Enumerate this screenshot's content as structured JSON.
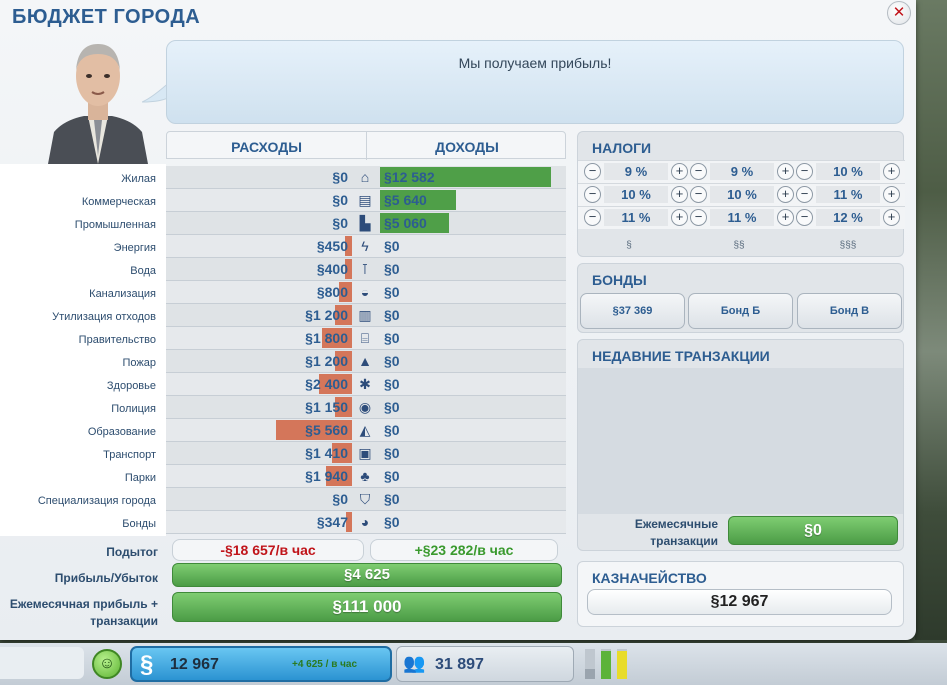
{
  "window": {
    "title": "БЮДЖЕТ ГОРОДА",
    "close_label": "✕"
  },
  "advisor": {
    "message": "Мы получаем прибыль!"
  },
  "columns": {
    "expenses": "РАСХОДЫ",
    "income": "ДОХОДЫ"
  },
  "rows": [
    {
      "label": "Жилая",
      "expense": "§0",
      "expense_fill": 0,
      "icon": "house-icon",
      "glyph": "⌂",
      "income": "§12 582",
      "income_fill": 0.92
    },
    {
      "label": "Коммерческая",
      "expense": "§0",
      "expense_fill": 0,
      "icon": "shop-icon",
      "glyph": "▤",
      "income": "§5 640",
      "income_fill": 0.41
    },
    {
      "label": "Промышленная",
      "expense": "§0",
      "expense_fill": 0,
      "icon": "factory-icon",
      "glyph": "▙",
      "income": "§5 060",
      "income_fill": 0.37
    },
    {
      "label": "Энергия",
      "expense": "§450",
      "expense_fill": 0.04,
      "icon": "lightning-icon",
      "glyph": "ϟ",
      "income": "§0",
      "income_fill": 0
    },
    {
      "label": "Вода",
      "expense": "§400",
      "expense_fill": 0.04,
      "icon": "faucet-icon",
      "glyph": "⊺",
      "income": "§0",
      "income_fill": 0
    },
    {
      "label": "Канализация",
      "expense": "§800",
      "expense_fill": 0.07,
      "icon": "sewage-icon",
      "glyph": "◒",
      "income": "§0",
      "income_fill": 0
    },
    {
      "label": "Утилизация отходов",
      "expense": "§1 200",
      "expense_fill": 0.09,
      "icon": "trash-icon",
      "glyph": "▥",
      "income": "§0",
      "income_fill": 0
    },
    {
      "label": "Правительство",
      "expense": "§1 800",
      "expense_fill": 0.16,
      "icon": "government-icon",
      "glyph": "⌸",
      "income": "§0",
      "income_fill": 0
    },
    {
      "label": "Пожар",
      "expense": "§1 200",
      "expense_fill": 0.09,
      "icon": "fire-helmet-icon",
      "glyph": "▲",
      "income": "§0",
      "income_fill": 0
    },
    {
      "label": "Здоровье",
      "expense": "§2 400",
      "expense_fill": 0.18,
      "icon": "medical-icon",
      "glyph": "✱",
      "income": "§0",
      "income_fill": 0
    },
    {
      "label": "Полиция",
      "expense": "§1 150",
      "expense_fill": 0.09,
      "icon": "police-badge-icon",
      "glyph": "◉",
      "income": "§0",
      "income_fill": 0
    },
    {
      "label": "Образование",
      "expense": "§5 560",
      "expense_fill": 0.41,
      "icon": "graduation-icon",
      "glyph": "◭",
      "income": "§0",
      "income_fill": 0
    },
    {
      "label": "Транспорт",
      "expense": "§1 410",
      "expense_fill": 0.11,
      "icon": "bus-icon",
      "glyph": "▣",
      "income": "§0",
      "income_fill": 0
    },
    {
      "label": "Парки",
      "expense": "§1 940",
      "expense_fill": 0.14,
      "icon": "tree-icon",
      "glyph": "♣",
      "income": "§0",
      "income_fill": 0
    },
    {
      "label": "Специализация города",
      "expense": "§0",
      "expense_fill": 0,
      "icon": "shield-icon",
      "glyph": "⛉",
      "income": "§0",
      "income_fill": 0
    },
    {
      "label": "Бонды",
      "expense": "§347",
      "expense_fill": 0.03,
      "icon": "money-bag-icon",
      "glyph": "◕",
      "income": "§0",
      "income_fill": 0
    }
  ],
  "subtotal": {
    "label": "Подытог",
    "expenses": "-§18 657/в час",
    "income": "+§23 282/в час"
  },
  "profit": {
    "label": "Прибыль/Убыток",
    "value": "§4 625"
  },
  "monthly": {
    "label": "Ежемесячная прибыль + транзакции",
    "value": "§111 000"
  },
  "taxes": {
    "title": "НАЛОГИ",
    "rows": [
      [
        "9 %",
        "9 %",
        "10 %"
      ],
      [
        "10 %",
        "10 %",
        "11 %"
      ],
      [
        "11 %",
        "11 %",
        "12 %"
      ]
    ],
    "tiers": [
      "§",
      "§§",
      "§§§"
    ],
    "minus": "−",
    "plus": "+"
  },
  "bonds": {
    "title": "БОНДЫ",
    "buttons": [
      "§37 369",
      "Бонд Б",
      "Бонд В"
    ]
  },
  "transactions": {
    "title": "НЕДАВНИЕ ТРАНЗАКЦИИ",
    "monthly_label": "Ежемесячные транзакции",
    "monthly_value": "§0"
  },
  "treasury": {
    "title": "КАЗНАЧЕЙСТВО",
    "value": "§12 967"
  },
  "status_bar": {
    "money": "12 967",
    "money_rate": "+4 625 / в час",
    "population": "31 897",
    "rci": [
      {
        "level": 0.35,
        "color": "#9aa4ae"
      },
      {
        "level": 0.95,
        "color": "#5cb33a"
      },
      {
        "level": 0.95,
        "color": "#e8dc2a"
      }
    ]
  },
  "colors": {
    "accent": "#2d5d91",
    "expense_bar": "#d4765a",
    "income_bar": "#4f9f48",
    "negative": "#c0141a",
    "positive": "#3a9a2e"
  }
}
